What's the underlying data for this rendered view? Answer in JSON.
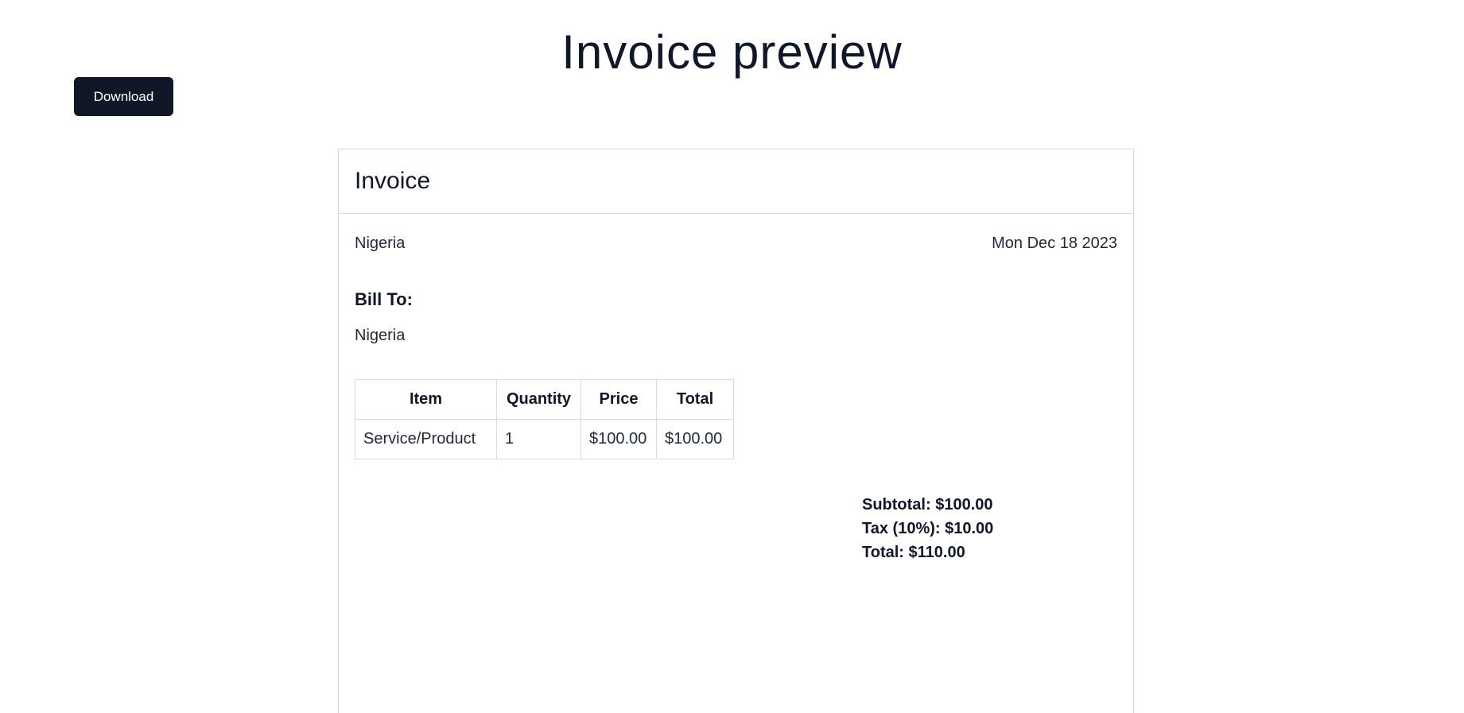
{
  "page": {
    "title": "Invoice preview"
  },
  "toolbar": {
    "download_label": "Download"
  },
  "invoice": {
    "title": "Invoice",
    "from": "Nigeria",
    "date": "Mon Dec 18 2023",
    "bill_to_heading": "Bill To:",
    "bill_to": "Nigeria",
    "table": {
      "headers": [
        "Item",
        "Quantity",
        "Price",
        "Total"
      ],
      "rows": [
        [
          "Service/Product",
          "1",
          "$100.00",
          "$100.00"
        ]
      ]
    },
    "totals": {
      "subtotal": "Subtotal: $100.00",
      "tax": "Tax (10%): $10.00",
      "total": "Total: $110.00"
    }
  },
  "colors": {
    "button_bg": "#101828",
    "text": "#0f172a",
    "border": "#d9d9d9"
  }
}
